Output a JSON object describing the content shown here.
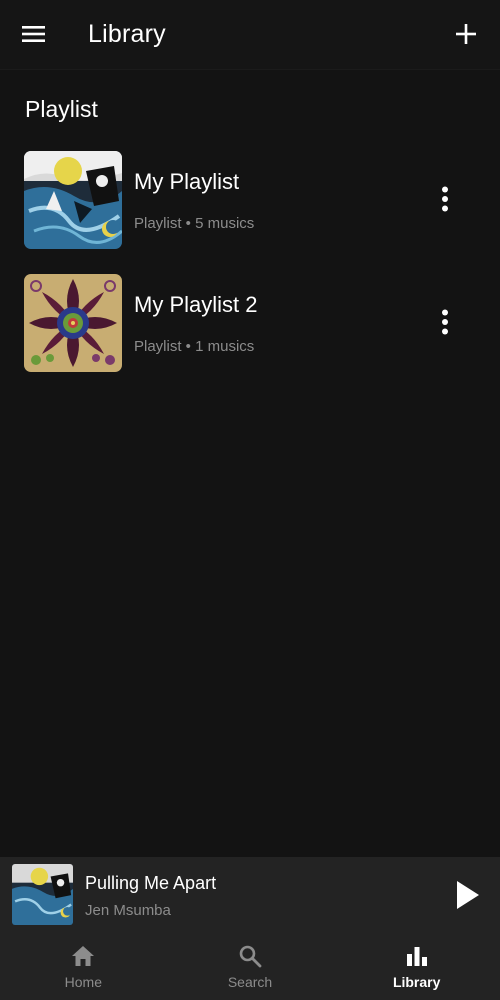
{
  "header": {
    "title": "Library",
    "menu_icon": "menu-icon",
    "add_icon": "plus-icon"
  },
  "section": {
    "title": "Playlist"
  },
  "playlists": [
    {
      "name": "My Playlist",
      "meta": "Playlist • 5 musics",
      "art": "dark-comic-cover",
      "more_icon": "more-vertical-icon"
    },
    {
      "name": "My Playlist 2",
      "meta": "Playlist • 1 musics",
      "art": "mandala-cover",
      "more_icon": "more-vertical-icon"
    }
  ],
  "player": {
    "title": "Pulling Me Apart",
    "artist": "Jen Msumba",
    "play_icon": "play-icon"
  },
  "nav": [
    {
      "label": "Home",
      "icon": "home-icon",
      "active": false
    },
    {
      "label": "Search",
      "icon": "search-icon",
      "active": false
    },
    {
      "label": "Library",
      "icon": "bar-chart-icon",
      "active": true
    }
  ],
  "colors": {
    "background": "#131313",
    "panel": "#232323",
    "text_primary": "#ffffff",
    "text_secondary": "#8c8c8c"
  }
}
